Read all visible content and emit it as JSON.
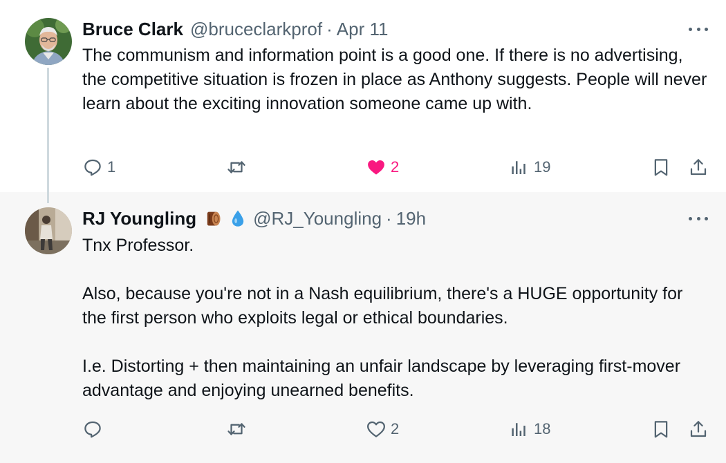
{
  "tweets": [
    {
      "name": "Bruce Clark",
      "handle": "@bruceclarkprof",
      "separator": "·",
      "time": "Apr 11",
      "text": "The communism and information point is a good one. If there is no advertising, the competitive situation is frozen in place as Anthony suggests. People will never learn about the exciting innovation someone came up with.",
      "replies": "1",
      "reposts": "",
      "likes": "2",
      "liked": true,
      "views": "19"
    },
    {
      "name": "RJ Youngling",
      "emojis": [
        "wood-log",
        "water-drop"
      ],
      "handle": "@RJ_Youngling",
      "separator": "·",
      "time": "19h",
      "text": "Tnx Professor.\n\nAlso, because you're not in a Nash equilibrium, there's a HUGE opportunity for the first person who exploits legal or ethical boundaries.\n\nI.e. Distorting + then maintaining an unfair landscape by leveraging first-mover advantage and enjoying unearned benefits.",
      "replies": "",
      "reposts": "",
      "likes": "2",
      "liked": false,
      "views": "18"
    }
  ],
  "colors": {
    "text": "#0f1419",
    "secondary": "#536471",
    "like_active": "#f91880",
    "thread_line": "#cfd9de",
    "reply_background": "#f7f7f7"
  }
}
